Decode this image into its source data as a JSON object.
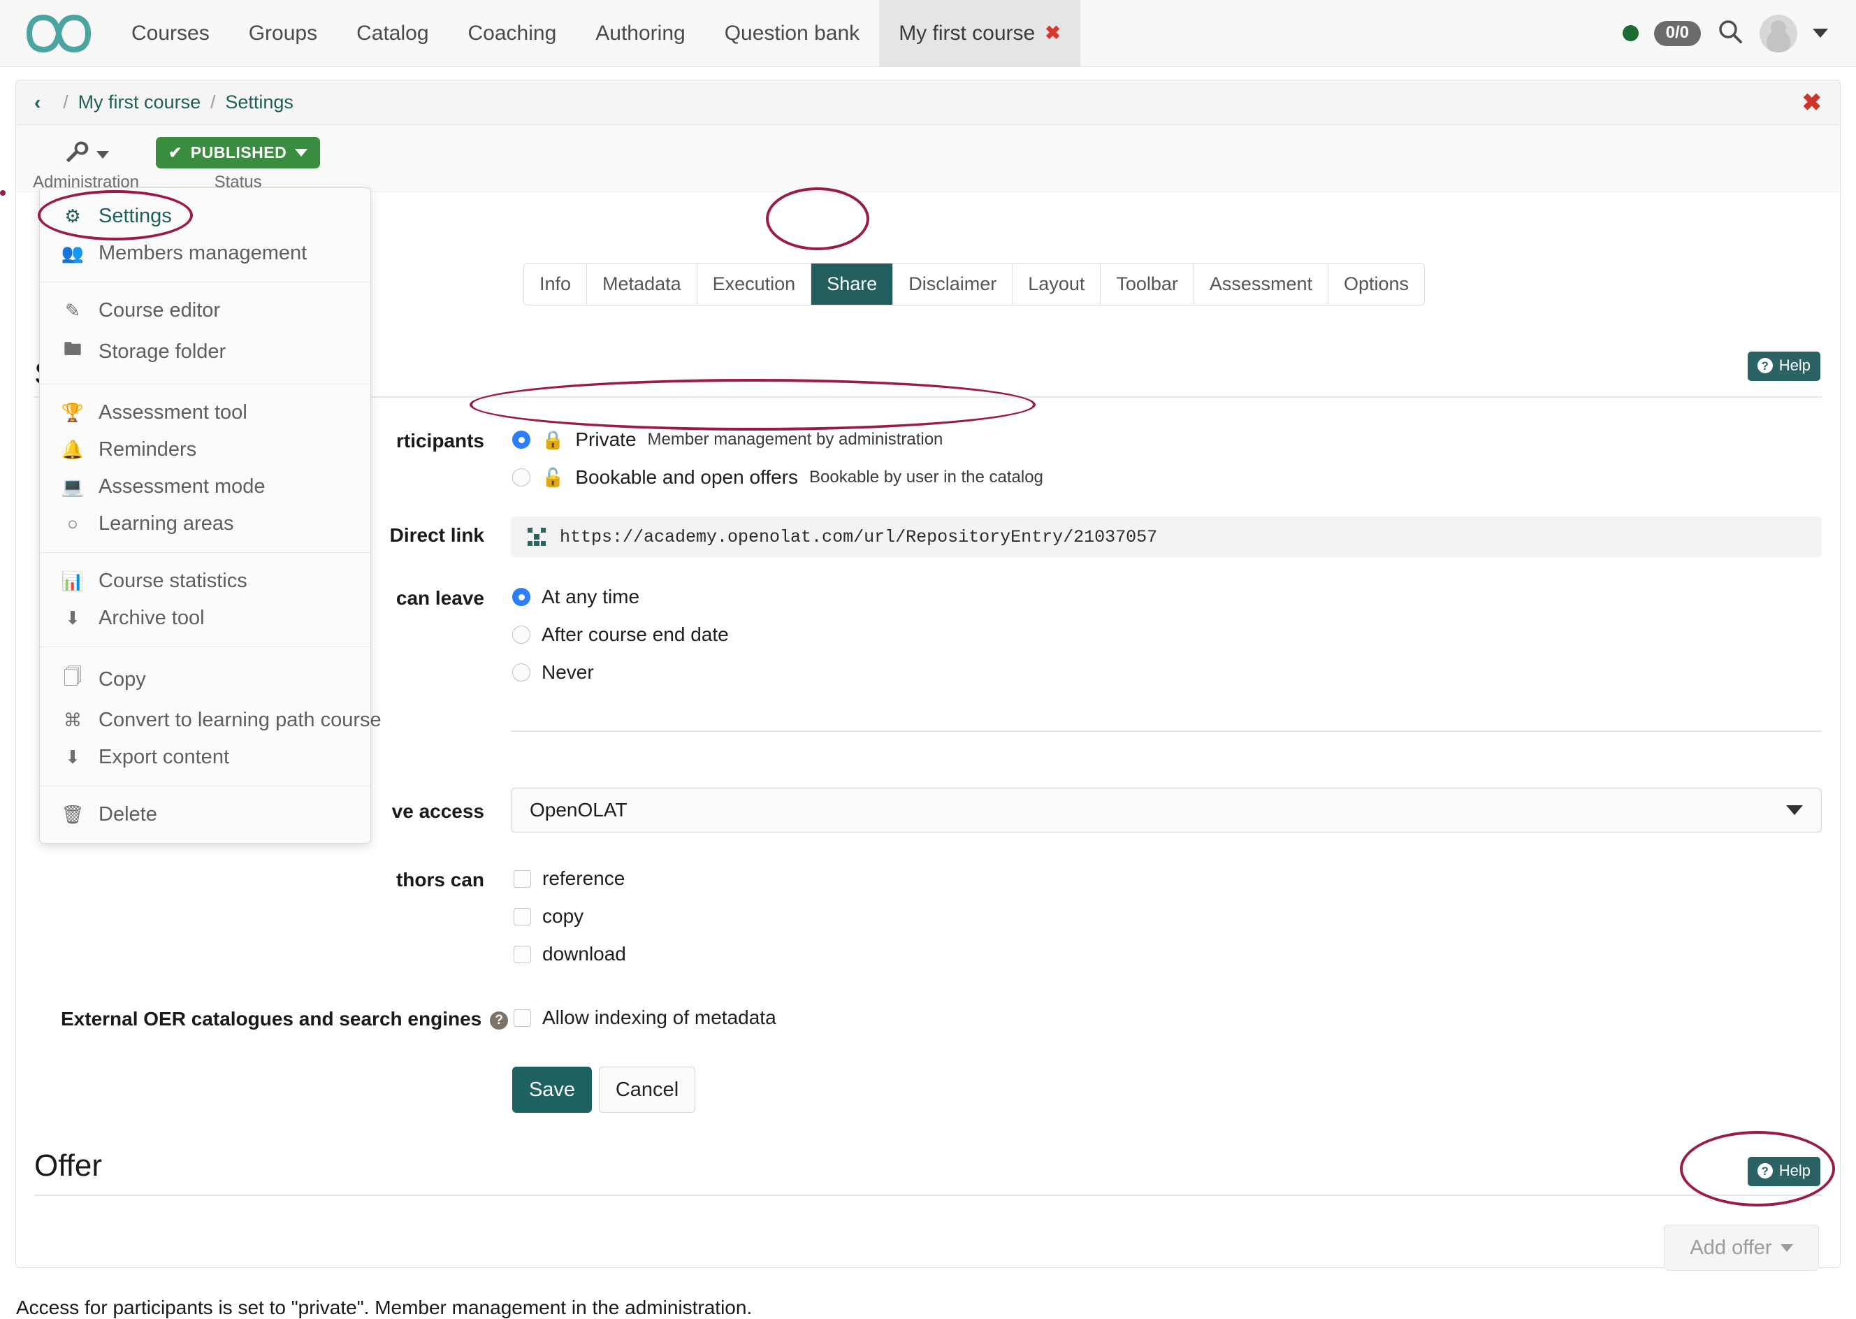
{
  "topnav": {
    "logo_name": "openolat-infinity-logo",
    "links": [
      {
        "label": "Courses",
        "active": false
      },
      {
        "label": "Groups",
        "active": false
      },
      {
        "label": "Catalog",
        "active": false
      },
      {
        "label": "Coaching",
        "active": false
      },
      {
        "label": "Authoring",
        "active": false
      },
      {
        "label": "Question bank",
        "active": false
      },
      {
        "label": "My first course",
        "active": true,
        "closable": true
      }
    ],
    "close_glyph": "✖",
    "status_dot_color": "#1d6b32",
    "notification_count": "0/0",
    "search_icon": "search-icon",
    "avatar_name": "user-avatar",
    "user_caret": "chevron-down-icon"
  },
  "breadcrumb": {
    "back_glyph": "‹",
    "separator": "/",
    "items": [
      "My first course",
      "Settings"
    ],
    "close_glyph": "✖"
  },
  "toolbar": {
    "administration_label": "Administration",
    "administration_icon": "wrench-icon",
    "status_label": "Status",
    "status_value": "PUBLISHED",
    "status_check": "✔",
    "status_color": "#3a8c3f"
  },
  "admin_menu": {
    "groups": [
      {
        "items": [
          {
            "label": "Settings",
            "icon": "gears-icon",
            "selected": true
          },
          {
            "label": "Members management",
            "icon": "users-icon",
            "selected": false
          }
        ]
      },
      {
        "items": [
          {
            "label": "Course editor",
            "icon": "edit-square-icon",
            "selected": false
          },
          {
            "label": "Storage folder",
            "icon": "folder-icon",
            "selected": false
          }
        ]
      },
      {
        "items": [
          {
            "label": "Assessment tool",
            "icon": "trophy-icon",
            "selected": false
          },
          {
            "label": "Reminders",
            "icon": "bell-icon",
            "selected": false
          },
          {
            "label": "Assessment mode",
            "icon": "laptop-pencil-icon",
            "selected": false
          },
          {
            "label": "Learning areas",
            "icon": "circle-icon",
            "selected": false
          }
        ]
      },
      {
        "items": [
          {
            "label": "Course statistics",
            "icon": "bar-chart-icon",
            "selected": false
          },
          {
            "label": "Archive tool",
            "icon": "download-tray-icon",
            "selected": false
          }
        ]
      },
      {
        "items": [
          {
            "label": "Copy",
            "icon": "copy-icon",
            "selected": false
          },
          {
            "label": "Convert to learning path course",
            "icon": "signpost-icon",
            "selected": false
          },
          {
            "label": "Export content",
            "icon": "download-tray-icon",
            "selected": false
          }
        ]
      },
      {
        "items": [
          {
            "label": "Delete",
            "icon": "trash-icon",
            "selected": false
          }
        ]
      }
    ]
  },
  "tabs": [
    {
      "label": "Info",
      "active": false
    },
    {
      "label": "Metadata",
      "active": false
    },
    {
      "label": "Execution",
      "active": false
    },
    {
      "label": "Share",
      "active": true
    },
    {
      "label": "Disclaimer",
      "active": false
    },
    {
      "label": "Layout",
      "active": false
    },
    {
      "label": "Toolbar",
      "active": false
    },
    {
      "label": "Assessment",
      "active": false
    },
    {
      "label": "Options",
      "active": false
    }
  ],
  "settings_section": {
    "title": "Settings",
    "title_visible_fragment": "S",
    "help_label": "Help",
    "help_icon": "question-mark-icon"
  },
  "form": {
    "access_label": "rticipants",
    "access_options": [
      {
        "label": "Private",
        "hint": "Member management by administration",
        "icon": "lock-closed-icon",
        "selected": true
      },
      {
        "label": "Bookable and open offers",
        "hint": "Bookable by user in the catalog",
        "icon": "lock-open-icon",
        "selected": false
      }
    ],
    "direct_link_label": "Direct link",
    "direct_link_value": "https://academy.openolat.com/url/RepositoryEntry/21037057",
    "direct_link_icon": "qr-code-icon",
    "leave_label": "can leave",
    "leave_options": [
      {
        "label": "At any time",
        "selected": true
      },
      {
        "label": "After course end date",
        "selected": false
      },
      {
        "label": "Never",
        "selected": false
      }
    ],
    "access_scope_label": "ve access",
    "access_scope_value": "OpenOLAT",
    "authors_label": "thors can",
    "author_permissions": [
      {
        "label": "reference",
        "checked": false
      },
      {
        "label": "copy",
        "checked": false
      },
      {
        "label": "download",
        "checked": false
      }
    ],
    "oer_label": "External OER catalogues and search engines",
    "oer_help_icon": "question-mark-circle-icon",
    "oer_option": {
      "label": "Allow indexing of metadata",
      "checked": false
    },
    "save_label": "Save",
    "cancel_label": "Cancel"
  },
  "offer_section": {
    "title": "Offer",
    "help_label": "Help",
    "add_offer_label": "Add offer",
    "add_offer_caret": "chevron-down-icon",
    "note": "Access for participants is set to \"private\". Member management in the administration."
  },
  "annotations": {
    "accent_color": "#9b1b44",
    "highlights": [
      "settings-menu-item",
      "share-tab",
      "bookable-open-offers-radio",
      "add-offer-button"
    ]
  }
}
